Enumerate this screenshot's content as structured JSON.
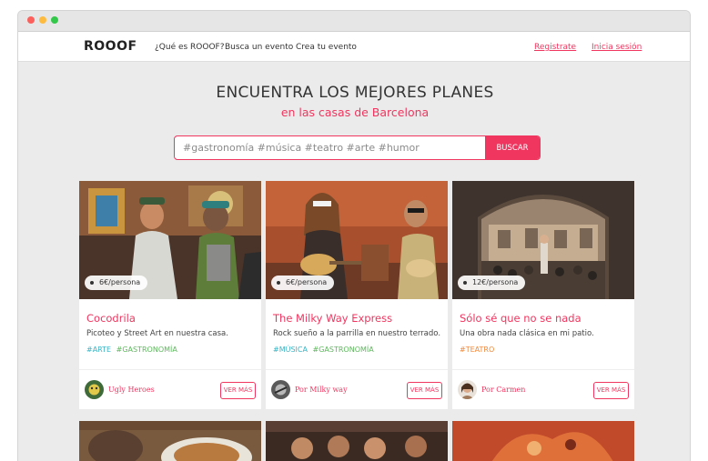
{
  "colors": {
    "accent": "#f0365f",
    "tag_teal": "#3bb3c3",
    "tag_green": "#5cb85c",
    "tag_orange": "#f0883a",
    "traffic_red": "#fc605c",
    "traffic_yellow": "#fdbc40",
    "traffic_green": "#34c84a"
  },
  "nav": {
    "logo": "ROOOF",
    "links": [
      "¿Qué es ROOOF?",
      "Busca un evento",
      "Crea tu evento"
    ],
    "register": "Registrate",
    "login": "Inicia sesión"
  },
  "hero": {
    "title": "ENCUENTRA LOS MEJORES PLANES",
    "subtitle": "en las casas de Barcelona"
  },
  "search": {
    "placeholder": "#gastronomía #música #teatro #arte #humor",
    "button": "BUSCAR"
  },
  "cards": [
    {
      "price": "6€/persona",
      "title": "Cocodrila",
      "description": "Picoteo y Street Art en nuestra casa.",
      "tags": [
        {
          "text": "#ARTE",
          "color": "teal"
        },
        {
          "text": "#GASTRONOMÍA",
          "color": "green"
        }
      ],
      "host": "Ugly Heroes",
      "button": "VER MÁS"
    },
    {
      "price": "6€/persona",
      "title": "The Milky Way Express",
      "description": "Rock sueño a la parrilla en nuestro terrado.",
      "tags": [
        {
          "text": "#MÚSICA",
          "color": "teal"
        },
        {
          "text": "#GASTRONOMÍA",
          "color": "green"
        }
      ],
      "host": "Por Milky way",
      "button": "VER MÁS"
    },
    {
      "price": "12€/persona",
      "title": "Sólo sé que no se nada",
      "description": "Una obra nada clásica en mi patio.",
      "tags": [
        {
          "text": "#TEATRO",
          "color": "orange"
        }
      ],
      "host": "Por Carmen",
      "button": "VER MÁS"
    }
  ]
}
